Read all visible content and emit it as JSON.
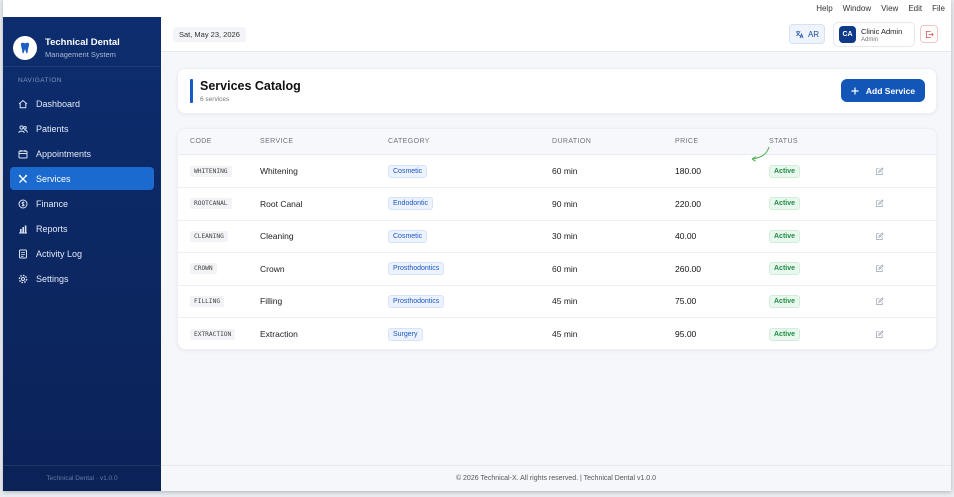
{
  "menubar": [
    "Help",
    "Window",
    "View",
    "Edit",
    "File"
  ],
  "brand": {
    "title": "Technical Dental",
    "subtitle": "Management System"
  },
  "navigation": {
    "heading": "NAVIGATION",
    "items": [
      {
        "label": "Dashboard",
        "icon": "home-icon"
      },
      {
        "label": "Patients",
        "icon": "users-icon"
      },
      {
        "label": "Appointments",
        "icon": "calendar-icon"
      },
      {
        "label": "Services",
        "icon": "tools-icon",
        "active": true
      },
      {
        "label": "Finance",
        "icon": "dollar-icon"
      },
      {
        "label": "Reports",
        "icon": "chart-icon"
      },
      {
        "label": "Activity Log",
        "icon": "log-icon"
      },
      {
        "label": "Settings",
        "icon": "gear-icon"
      }
    ]
  },
  "sidebar_footer": "Technical Dental  ·  v1.0.0",
  "topbar": {
    "date": "Sat, May 23, 2026",
    "lang_label": "AR",
    "user": {
      "initials": "CA",
      "name": "Clinic Admin",
      "role": "Admin"
    }
  },
  "page": {
    "title": "Services Catalog",
    "subtitle": "6 services",
    "add_button": "Add Service"
  },
  "table": {
    "headers": [
      "CODE",
      "SERVICE",
      "CATEGORY",
      "DURATION",
      "PRICE",
      "STATUS"
    ],
    "rows": [
      {
        "code": "WHITENING",
        "service": "Whitening",
        "category": "Cosmetic",
        "duration": "60 min",
        "price": "180.00",
        "status": "Active"
      },
      {
        "code": "ROOTCANAL",
        "service": "Root Canal",
        "category": "Endodontic",
        "duration": "90 min",
        "price": "220.00",
        "status": "Active"
      },
      {
        "code": "CLEANING",
        "service": "Cleaning",
        "category": "Cosmetic",
        "duration": "30 min",
        "price": "40.00",
        "status": "Active"
      },
      {
        "code": "CROWN",
        "service": "Crown",
        "category": "Prosthodontics",
        "duration": "60 min",
        "price": "260.00",
        "status": "Active"
      },
      {
        "code": "FILLING",
        "service": "Filling",
        "category": "Prosthodontics",
        "duration": "45 min",
        "price": "75.00",
        "status": "Active"
      },
      {
        "code": "EXTRACTION",
        "service": "Extraction",
        "category": "Surgery",
        "duration": "45 min",
        "price": "95.00",
        "status": "Active"
      }
    ]
  },
  "footer": "© 2026 Technical-X. All rights reserved. | Technical Dental v1.0.0",
  "colors": {
    "sidebar": "#0d2d6e",
    "accent": "#1257b8",
    "active_status": "#1d8f45"
  }
}
